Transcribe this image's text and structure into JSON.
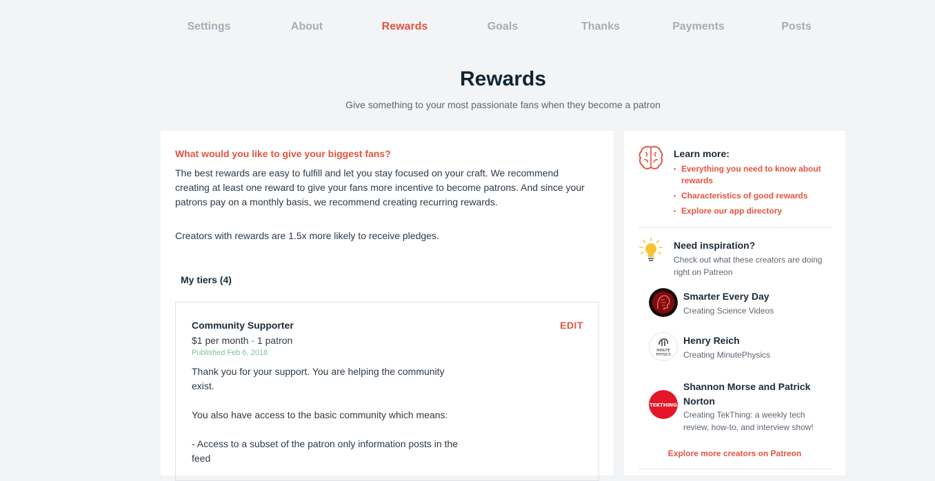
{
  "nav": {
    "tabs": [
      {
        "label": "Settings"
      },
      {
        "label": "About"
      },
      {
        "label": "Rewards"
      },
      {
        "label": "Goals"
      },
      {
        "label": "Thanks"
      },
      {
        "label": "Payments"
      },
      {
        "label": "Posts"
      }
    ],
    "active_tab": "Rewards"
  },
  "header": {
    "title": "Rewards",
    "subtitle": "Give something to your most passionate fans when they become a patron"
  },
  "main": {
    "question": "What would you like to give your biggest fans?",
    "intro": "The best rewards are easy to fulfill and let you stay focused on your craft. We recommend creating at least one reward to give your fans more incentive to become patrons. And since your patrons pay on a monthly basis, we recommend creating recurring rewards.",
    "stat": "Creators with rewards are 1.5x more likely to receive pledges.",
    "tiers_heading": "My tiers (4)",
    "tier": {
      "name": "Community Supporter",
      "edit_label": "EDIT",
      "price": "$1 per month · 1 patron",
      "published": "Published Feb 6, 2018",
      "description": [
        "Thank you for your support. You are helping the community exist.",
        "You also have access to the basic community which means:",
        "- Access to a subset of the patron only information posts in the feed"
      ]
    }
  },
  "sidebar": {
    "learn": {
      "title": "Learn more:",
      "links": [
        "Everything you need to know about rewards",
        "Characteristics of good rewards",
        "Explore our app directory"
      ]
    },
    "inspiration": {
      "title": "Need inspiration?",
      "subtitle": "Check out what these creators are doing right on Patreon"
    },
    "creators": [
      {
        "name": "Smarter Every Day",
        "desc": "Creating Science Videos"
      },
      {
        "name": "Henry Reich",
        "desc": "Creating MinutePhysics",
        "avatar_text": "MINUTE PHYSICS"
      },
      {
        "name": "Shannon Morse and Patrick Norton",
        "desc": "Creating TekThing: a weekly tech review, how-to, and interview show!",
        "avatar_text": "TEKTHING"
      }
    ],
    "explore_label": "Explore more creators on Patreon"
  },
  "colors": {
    "accent": "#e4533f",
    "published_green": "#7cc197",
    "background": "#f2f4f6",
    "bulb_yellow": "#f8c233"
  },
  "icons": {
    "learn": "brain-icon",
    "inspiration": "lightbulb-icon"
  }
}
